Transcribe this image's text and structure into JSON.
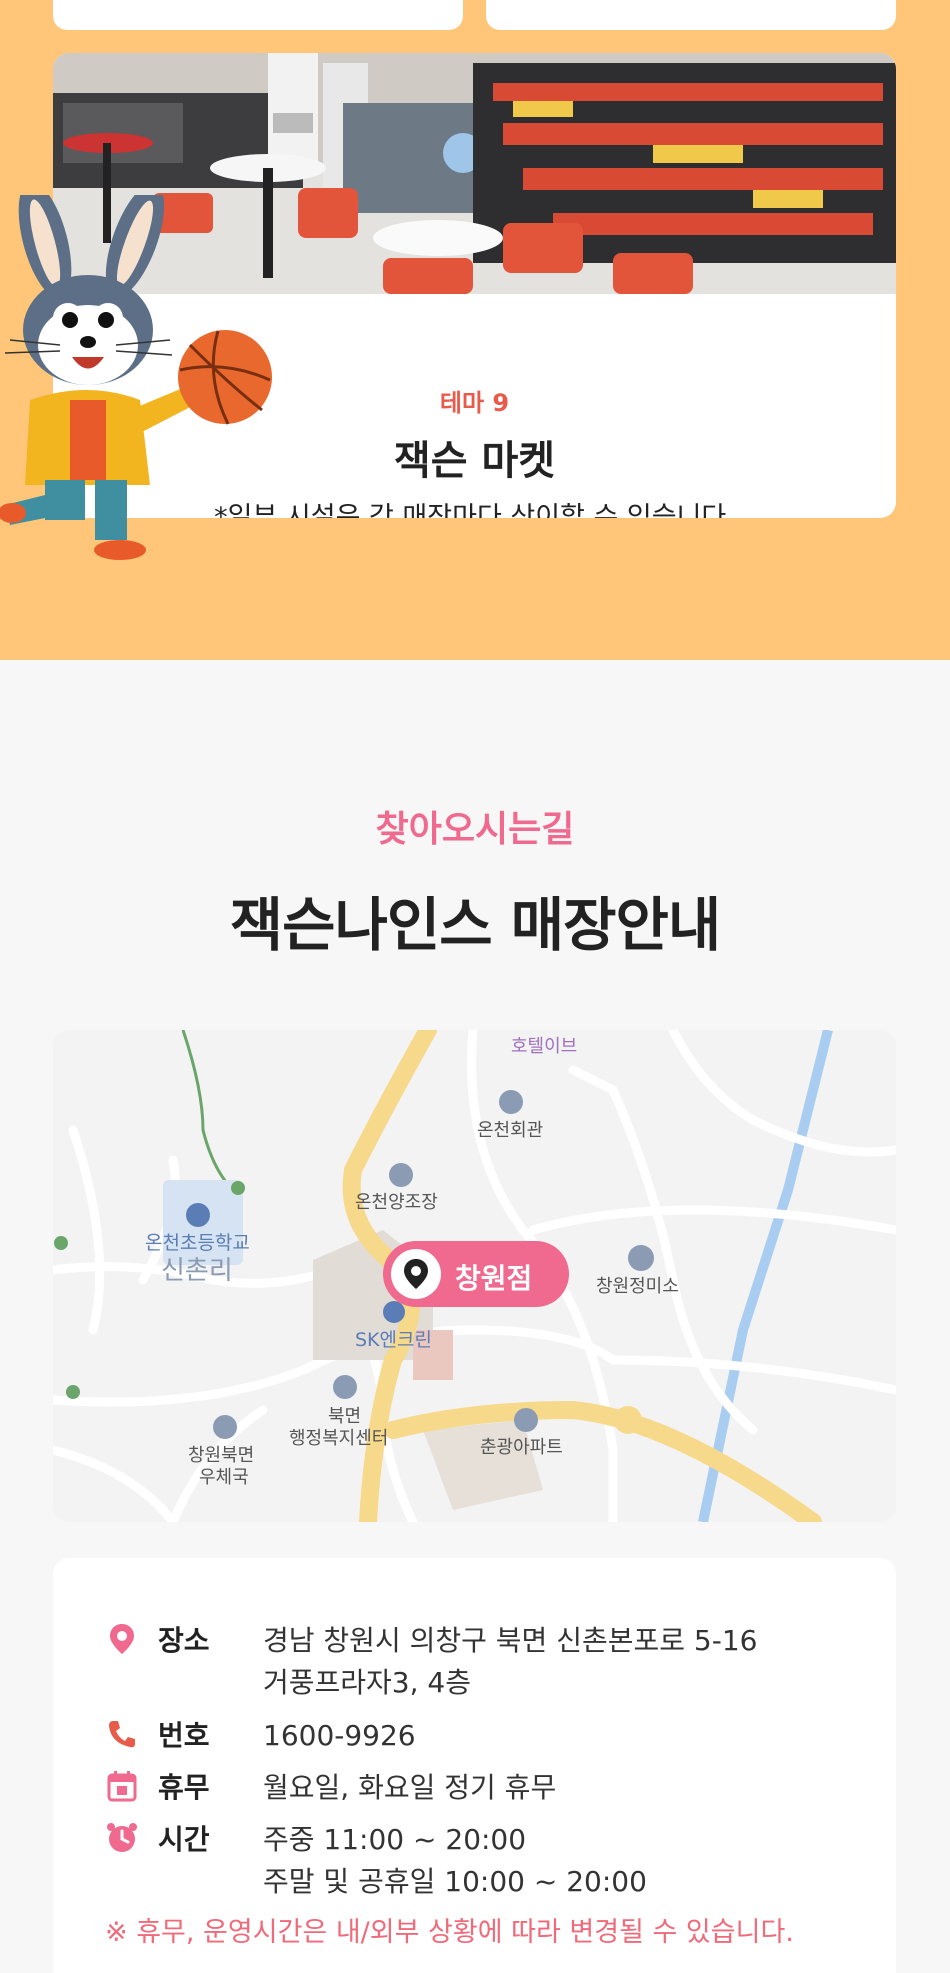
{
  "theme": {
    "number": "테마 9",
    "title": "잭슨 마켓",
    "note": "*일부 시설은 각 매장마다 상이할 수 있습니다."
  },
  "directions": {
    "subtitle": "찾아오시는길",
    "title": "잭슨나인스 매장안내"
  },
  "map": {
    "marker_label": "창원점",
    "places": [
      "호텔이브",
      "온천회관",
      "온천양조장",
      "온천초등학교",
      "신촌리",
      "창원정미소",
      "SK엔크린",
      "북면",
      "행정복지센터",
      "창원북면",
      "우체국",
      "춘광아파트"
    ]
  },
  "info": {
    "location": {
      "label": "장소",
      "line1": "경남 창원시 의창구 북면 신촌본포로 5-16",
      "line2": "거풍프라자3, 4층"
    },
    "phone": {
      "label": "번호",
      "value": "1600-9926"
    },
    "closed": {
      "label": "휴무",
      "value": "월요일, 화요일 정기 휴무"
    },
    "hours": {
      "label": "시간",
      "weekday": "주중 11:00 ~ 20:00",
      "weekend": "주말 및 공휴일 10:00 ~ 20:00"
    },
    "notice": "※ 휴무, 운영시간은 내/외부 상황에 따라 변경될 수 있습니다."
  },
  "colors": {
    "orange_bg": "#ffc67a",
    "pink_accent": "#f06a8f",
    "red_theme": "#e85a4a"
  }
}
